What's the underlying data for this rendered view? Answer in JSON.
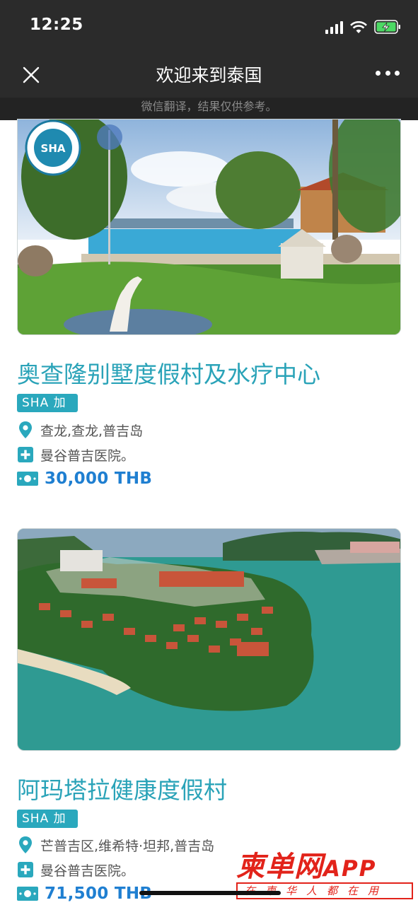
{
  "status_bar": {
    "time": "12:25"
  },
  "nav": {
    "title": "欢迎来到泰国",
    "subtitle": "微信翻译，结果仅供参考。",
    "close_icon": "close-icon",
    "more_icon": "more-icon"
  },
  "listings": [
    {
      "image": "resort-pool-garden-photo",
      "seal_text": "SHA",
      "name": "奥查隆别墅度假村及水疗中心",
      "badge": "SHA 加",
      "location": "查龙,查龙,普吉岛",
      "hospital": "曼谷普吉医院。",
      "price": "30,000 THB"
    },
    {
      "image": "aerial-peninsula-resort-photo",
      "name": "阿玛塔拉健康度假村",
      "badge": "SHA 加",
      "location": "芒普吉区,维希特·坦邦,普吉岛",
      "hospital": "曼谷普吉医院。",
      "price": "71,500 THB"
    }
  ],
  "watermark": {
    "title": "柬单网",
    "app": "APP",
    "slogan": "在柬华人都在用"
  },
  "colors": {
    "accent": "#2aa3b8",
    "price": "#1f7fd1",
    "header_bg": "#2b2b2b",
    "watermark": "#e2231a"
  }
}
